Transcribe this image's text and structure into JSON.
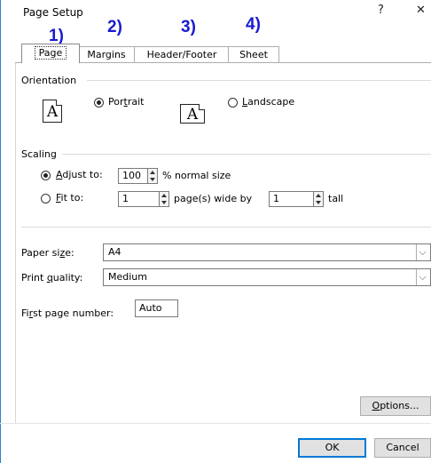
{
  "window": {
    "title": "Page Setup",
    "help_glyph": "?",
    "close_glyph": "✕"
  },
  "annotations": [
    "1)",
    "2)",
    "3)",
    "4)"
  ],
  "tabs": [
    "Page",
    "Margins",
    "Header/Footer",
    "Sheet"
  ],
  "orientation": {
    "label": "Orientation",
    "portrait": "Portrait",
    "landscape": "Landscape",
    "selected": "portrait",
    "icon_glyph": "A"
  },
  "scaling": {
    "label": "Scaling",
    "adjust_label": "Adjust to:",
    "adjust_value": "100",
    "adjust_suffix": "% normal size",
    "fit_label": "Fit to:",
    "fit_wide_value": "1",
    "fit_wide_suffix": "page(s) wide by",
    "fit_tall_value": "1",
    "fit_tall_suffix": "tall",
    "selected": "adjust"
  },
  "paper_size": {
    "label": "Paper size:",
    "value": "A4"
  },
  "print_quality": {
    "label": "Print quality:",
    "value": "Medium"
  },
  "first_page": {
    "label": "First page number:",
    "value": "Auto"
  },
  "buttons": {
    "options": "Options...",
    "ok": "OK",
    "cancel": "Cancel"
  },
  "colors": {
    "annotation": "#1a1ad0",
    "focus": "#0078d7"
  }
}
